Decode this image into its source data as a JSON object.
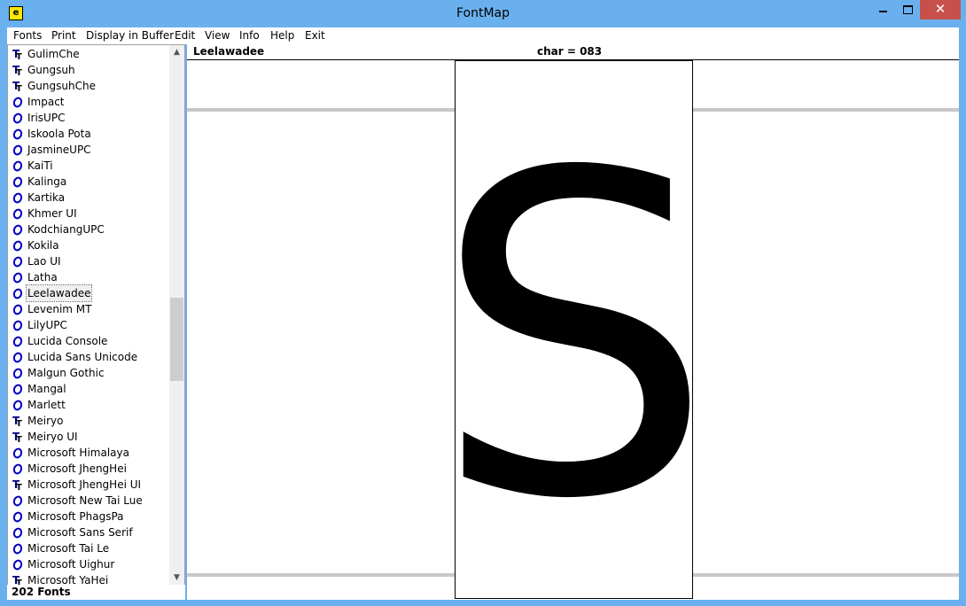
{
  "window": {
    "title": "FontMap",
    "app_icon_glyph": "e",
    "min_glyph": "",
    "close_glyph": "✕"
  },
  "menu": [
    "Fonts",
    "Print",
    "Display in Buffer",
    "Edit",
    "View",
    "Info",
    "Help",
    "Exit"
  ],
  "font_list": {
    "items": [
      {
        "name": "GulimChe",
        "icon": "truetype-icon"
      },
      {
        "name": "Gungsuh",
        "icon": "truetype-icon"
      },
      {
        "name": "GungsuhChe",
        "icon": "truetype-icon"
      },
      {
        "name": "Impact",
        "icon": "opentype-icon"
      },
      {
        "name": "IrisUPC",
        "icon": "opentype-icon"
      },
      {
        "name": "Iskoola Pota",
        "icon": "opentype-icon"
      },
      {
        "name": "JasmineUPC",
        "icon": "opentype-icon"
      },
      {
        "name": "KaiTi",
        "icon": "opentype-icon"
      },
      {
        "name": "Kalinga",
        "icon": "opentype-icon"
      },
      {
        "name": "Kartika",
        "icon": "opentype-icon"
      },
      {
        "name": "Khmer UI",
        "icon": "opentype-icon"
      },
      {
        "name": "KodchiangUPC",
        "icon": "opentype-icon"
      },
      {
        "name": "Kokila",
        "icon": "opentype-icon"
      },
      {
        "name": "Lao UI",
        "icon": "opentype-icon"
      },
      {
        "name": "Latha",
        "icon": "opentype-icon"
      },
      {
        "name": "Leelawadee",
        "icon": "opentype-icon",
        "selected": true
      },
      {
        "name": "Levenim MT",
        "icon": "opentype-icon"
      },
      {
        "name": "LilyUPC",
        "icon": "opentype-icon"
      },
      {
        "name": "Lucida Console",
        "icon": "opentype-icon"
      },
      {
        "name": "Lucida Sans Unicode",
        "icon": "opentype-icon"
      },
      {
        "name": "Malgun Gothic",
        "icon": "opentype-icon"
      },
      {
        "name": "Mangal",
        "icon": "opentype-icon"
      },
      {
        "name": "Marlett",
        "icon": "opentype-icon"
      },
      {
        "name": "Meiryo",
        "icon": "truetype-icon"
      },
      {
        "name": "Meiryo UI",
        "icon": "truetype-icon"
      },
      {
        "name": "Microsoft Himalaya",
        "icon": "opentype-icon"
      },
      {
        "name": "Microsoft JhengHei",
        "icon": "opentype-icon"
      },
      {
        "name": "Microsoft JhengHei UI",
        "icon": "truetype-icon"
      },
      {
        "name": "Microsoft New Tai Lue",
        "icon": "opentype-icon"
      },
      {
        "name": "Microsoft PhagsPa",
        "icon": "opentype-icon"
      },
      {
        "name": "Microsoft Sans Serif",
        "icon": "opentype-icon"
      },
      {
        "name": "Microsoft Tai Le",
        "icon": "opentype-icon"
      },
      {
        "name": "Microsoft Uighur",
        "icon": "opentype-icon"
      },
      {
        "name": "Microsoft YaHei",
        "icon": "truetype-icon"
      }
    ],
    "status": "202 Fonts"
  },
  "preview": {
    "font_name": "Leelawadee",
    "char_code": "char = 083",
    "glyph": "S"
  },
  "colors": {
    "title_bar": "#6ab0ee",
    "close_button": "#c7504b",
    "truetype_icon": "#000080",
    "opentype_icon": "#0000c0"
  }
}
